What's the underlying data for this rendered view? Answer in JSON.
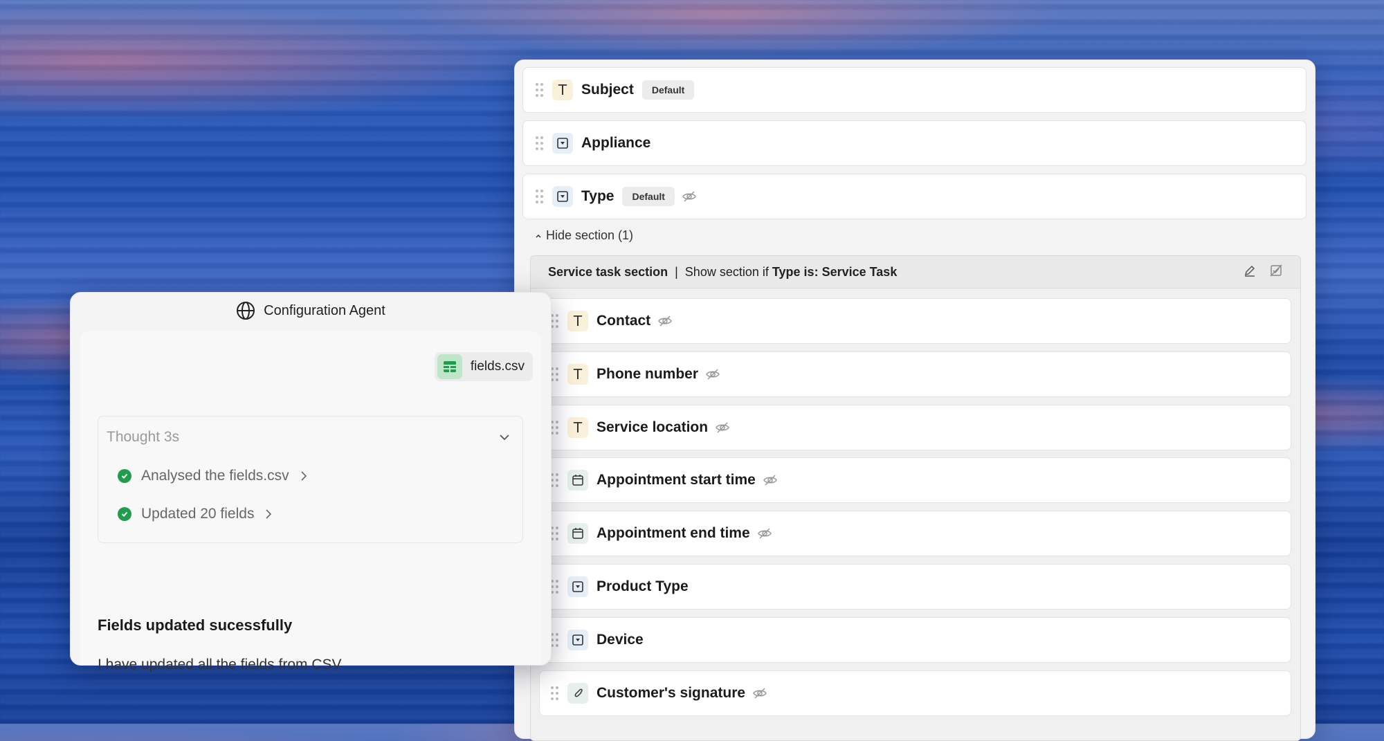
{
  "form": {
    "fields_top": [
      {
        "label": "Subject",
        "type_icon": "text-type-icon",
        "badge": "Default",
        "hidden": false
      },
      {
        "label": "Appliance",
        "type_icon": "dropdown-type-icon",
        "badge": "",
        "hidden": false
      },
      {
        "label": "Type",
        "type_icon": "dropdown-type-icon",
        "badge": "Default",
        "hidden": true
      }
    ],
    "hide_section_toggle": "Hide section (1)",
    "section": {
      "name": "Service task section",
      "separator": "|",
      "condition_prefix": "Show section if",
      "condition_field": "Type is:",
      "condition_value": "Service Task",
      "fields": [
        {
          "label": "Contact",
          "type_icon": "text-type-icon",
          "hidden": true
        },
        {
          "label": "Phone number",
          "type_icon": "text-type-icon",
          "hidden": true
        },
        {
          "label": "Service location",
          "type_icon": "text-type-icon",
          "hidden": true
        },
        {
          "label": "Appointment start time",
          "type_icon": "calendar-type-icon",
          "hidden": true
        },
        {
          "label": "Appointment end time",
          "type_icon": "calendar-type-icon",
          "hidden": true
        },
        {
          "label": "Product Type",
          "type_icon": "dropdown-type-icon",
          "hidden": false
        },
        {
          "label": "Device",
          "type_icon": "dropdown-type-icon",
          "hidden": false
        },
        {
          "label": "Customer's signature",
          "type_icon": "attachment-type-icon",
          "hidden": true
        }
      ]
    }
  },
  "chat": {
    "title": "Configuration Agent",
    "attachment": "fields.csv",
    "thought_label": "Thought 3s",
    "steps": [
      "Analysed the fields.csv",
      "Updated 20 fields"
    ],
    "result_title": "Fields updated sucessfully",
    "result_text": "I have updated all the fields from CSV"
  },
  "colors": {
    "success": "#1f9d4c",
    "csv_icon": "#1f9d4c"
  }
}
